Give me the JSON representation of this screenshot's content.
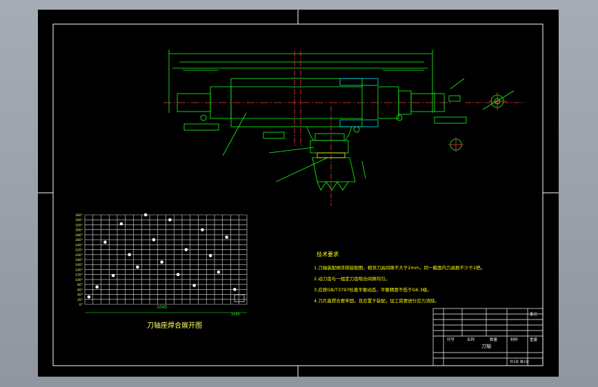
{
  "drawing": {
    "chart_caption": "刀轴座焊合展开图",
    "notes_title": "技术要求",
    "notes": [
      "1.刀轴装配顺序按装配图，相邻刀具间隙不大于2mm，同一截面内刀具数不少于2把。",
      "2.动刀齿与一组定刀齿啮合间隙均匀。",
      "3.应按GB/T3797检查平衡动态，平衡精度不低于G6.3级。",
      "4.刀片座焊合要牢固，且应置于装配，加工前要进行应力消除。"
    ],
    "title_block": {
      "part_name": "刀轴",
      "headers": [
        "代号",
        "名称",
        "数量",
        "材料",
        "重量",
        "备注"
      ],
      "sheet": "共1张 第1张"
    },
    "chart_tick_labels": [
      "0°",
      "20°",
      "40°",
      "60°",
      "80°",
      "100°",
      "120°",
      "140°",
      "160°",
      "180°",
      "200°",
      "220°",
      "240°",
      "260°",
      "280°",
      "300°",
      "320°",
      "340°",
      "360°"
    ],
    "chart_length_label": "1040",
    "chart_small_label": "1040",
    "colors": {
      "line": "#19ff19",
      "frame": "#ffffff",
      "red": "#ff3b3b",
      "cyan": "#00e5ff",
      "yellow": "#ffff00"
    }
  }
}
